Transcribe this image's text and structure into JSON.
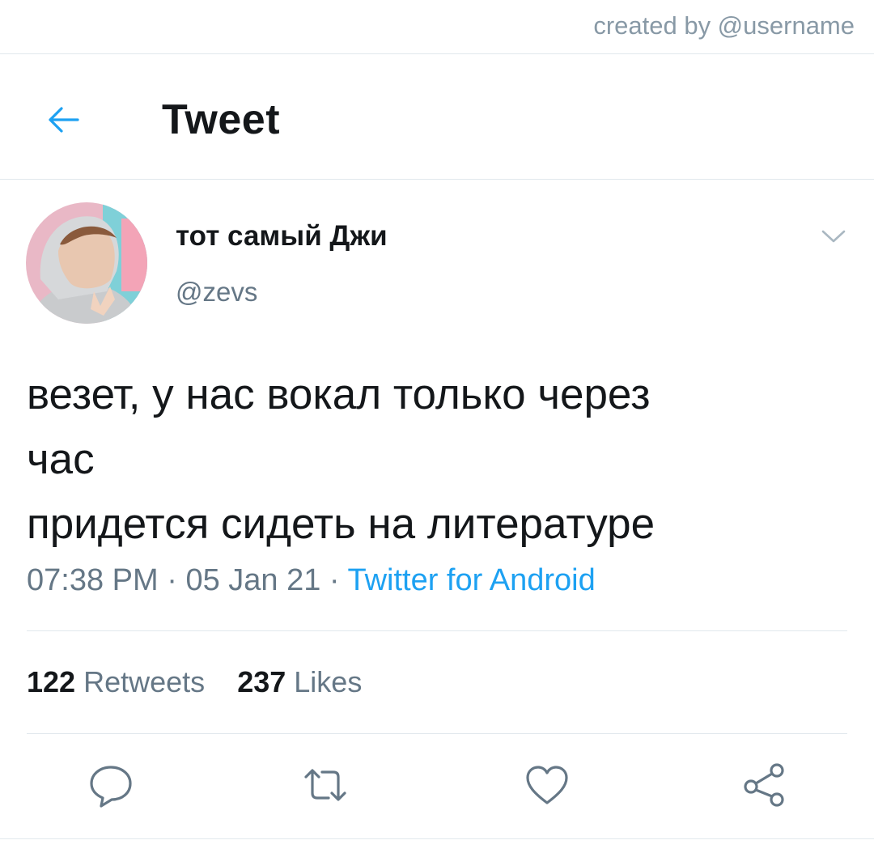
{
  "watermark": "created by @username",
  "header": {
    "back_icon": "arrow-left-icon",
    "title": "Tweet"
  },
  "tweet": {
    "display_name": "тот самый Джи",
    "handle": "@zevs",
    "text": "везет, у нас вокал только через\nчас\nпридется сидеть на литературе",
    "time": "07:38 PM",
    "separator": " · ",
    "date": "05 Jan 21",
    "source": "Twitter for Android"
  },
  "stats": {
    "retweets_count": "122",
    "retweets_label": "Retweets",
    "likes_count": "237",
    "likes_label": "Likes"
  },
  "actions": {
    "reply_icon": "reply-icon",
    "retweet_icon": "retweet-icon",
    "like_icon": "heart-icon",
    "share_icon": "share-icon"
  },
  "colors": {
    "accent": "#1da1f2",
    "text_primary": "#14171a",
    "text_secondary": "#657786",
    "divider": "#e1e8ed"
  }
}
